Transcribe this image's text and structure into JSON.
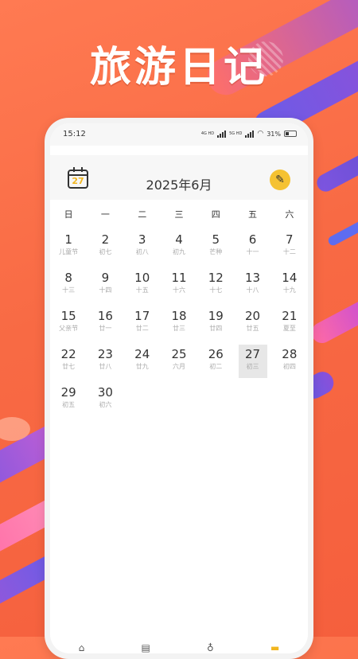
{
  "app_title": "旅游日记",
  "status_bar": {
    "time": "15:12",
    "network_1": "4G HD",
    "network_2": "5G HD",
    "battery": "31%"
  },
  "header": {
    "calendar_icon_day": "27",
    "month_label": "2025年6月"
  },
  "weekdays": [
    "日",
    "一",
    "二",
    "三",
    "四",
    "五",
    "六"
  ],
  "calendar": [
    [
      {
        "day": "1",
        "lunar": "儿童节"
      },
      {
        "day": "2",
        "lunar": "初七"
      },
      {
        "day": "3",
        "lunar": "初八"
      },
      {
        "day": "4",
        "lunar": "初九"
      },
      {
        "day": "5",
        "lunar": "芒种"
      },
      {
        "day": "6",
        "lunar": "十一"
      },
      {
        "day": "7",
        "lunar": "十二"
      }
    ],
    [
      {
        "day": "8",
        "lunar": "十三"
      },
      {
        "day": "9",
        "lunar": "十四"
      },
      {
        "day": "10",
        "lunar": "十五"
      },
      {
        "day": "11",
        "lunar": "十六"
      },
      {
        "day": "12",
        "lunar": "十七"
      },
      {
        "day": "13",
        "lunar": "十八"
      },
      {
        "day": "14",
        "lunar": "十九"
      }
    ],
    [
      {
        "day": "15",
        "lunar": "父亲节"
      },
      {
        "day": "16",
        "lunar": "廿一"
      },
      {
        "day": "17",
        "lunar": "廿二"
      },
      {
        "day": "18",
        "lunar": "廿三"
      },
      {
        "day": "19",
        "lunar": "廿四"
      },
      {
        "day": "20",
        "lunar": "廿五"
      },
      {
        "day": "21",
        "lunar": "夏至"
      }
    ],
    [
      {
        "day": "22",
        "lunar": "廿七"
      },
      {
        "day": "23",
        "lunar": "廿八"
      },
      {
        "day": "24",
        "lunar": "廿九"
      },
      {
        "day": "25",
        "lunar": "六月"
      },
      {
        "day": "26",
        "lunar": "初二"
      },
      {
        "day": "27",
        "lunar": "初三",
        "selected": true
      },
      {
        "day": "28",
        "lunar": "初四"
      }
    ],
    [
      {
        "day": "29",
        "lunar": "初五"
      },
      {
        "day": "30",
        "lunar": "初六"
      }
    ]
  ],
  "icons": {
    "calendar": "calendar-icon",
    "edit": "pencil-icon",
    "wifi": "wifi-icon",
    "battery": "battery-icon"
  },
  "colors": {
    "background": "#f86a44",
    "accent": "#f5c232",
    "selected_cell": "#e7e7e7"
  }
}
